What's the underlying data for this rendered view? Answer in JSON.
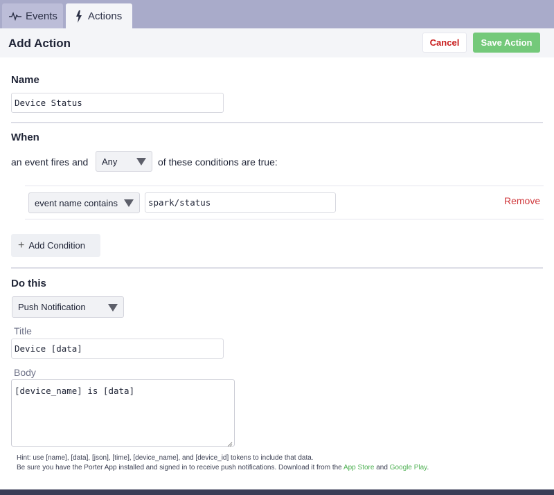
{
  "tabs": [
    {
      "label": "Events",
      "icon": "pulse-icon"
    },
    {
      "label": "Actions",
      "icon": "lightning-icon"
    }
  ],
  "header": {
    "title": "Add Action",
    "cancel_label": "Cancel",
    "save_label": "Save Action"
  },
  "name_section": {
    "label": "Name",
    "value": "Device Status"
  },
  "when_section": {
    "label": "When",
    "prefix_text": "an event fires and",
    "match_select": "Any",
    "suffix_text": "of these conditions are true:",
    "conditions": [
      {
        "operator": "event name contains",
        "value": "spark/status",
        "remove_label": "Remove"
      }
    ],
    "add_condition_label": "Add Condition"
  },
  "do_section": {
    "label": "Do this",
    "action_select": "Push Notification",
    "title_label": "Title",
    "title_value": "Device [data]",
    "body_label": "Body",
    "body_value": "[device_name] is [data]"
  },
  "hint": {
    "line1": "Hint: use [name], [data], [json], [time], [device_name], and [device_id] tokens to include that data.",
    "line2_prefix": "Be sure you have the Porter App installed and signed in to receive push notifications. Download it from the ",
    "app_store_link": "App Store",
    "and_text": " and ",
    "google_play_link": "Google Play",
    "line2_suffix": "."
  },
  "colors": {
    "tabbar": "#a9abca",
    "save_button": "#74c97a",
    "cancel_text": "#c81b1b",
    "remove_text": "#d0383c",
    "link": "#4caf50"
  }
}
